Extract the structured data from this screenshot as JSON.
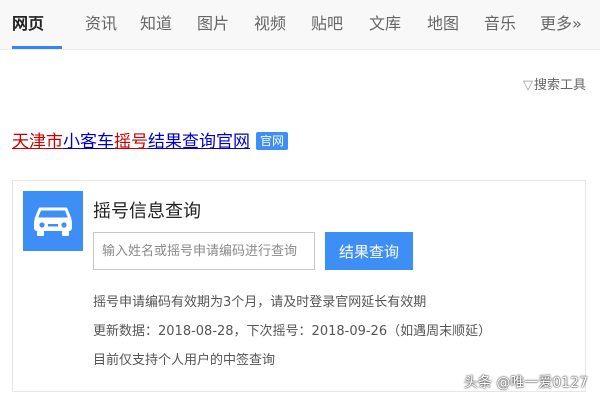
{
  "nav": {
    "tabs": [
      {
        "label": "网页",
        "active": true
      },
      {
        "label": "资讯"
      },
      {
        "label": "知道"
      },
      {
        "label": "图片"
      },
      {
        "label": "视频"
      },
      {
        "label": "贴吧"
      },
      {
        "label": "文库"
      },
      {
        "label": "地图"
      },
      {
        "label": "音乐"
      },
      {
        "label": "更多»"
      }
    ]
  },
  "tools": {
    "icon": "funnel-icon",
    "label": "搜索工具"
  },
  "result": {
    "title_parts": [
      "天津市",
      "小客车",
      "摇号",
      "结果查询",
      "官网"
    ],
    "badge": "官网"
  },
  "card": {
    "icon": "car-icon",
    "heading": "摇号信息查询",
    "input_placeholder": "输入姓名或摇号申请编码进行查询",
    "button_label": "结果查询",
    "lines": [
      "摇号申请编码有效期为3个月，请及时登录官网延长有效期",
      "更新数据：2018-08-28，下次摇号：2018-09-26（如遇周末顺延）",
      "目前仅支持个人用户的中签查询"
    ]
  },
  "watermark": "头条 @唯一爱0127",
  "colors": {
    "accent": "#3d8ff5",
    "title_red": "#cc0000",
    "title_blue": "#0000cc"
  }
}
